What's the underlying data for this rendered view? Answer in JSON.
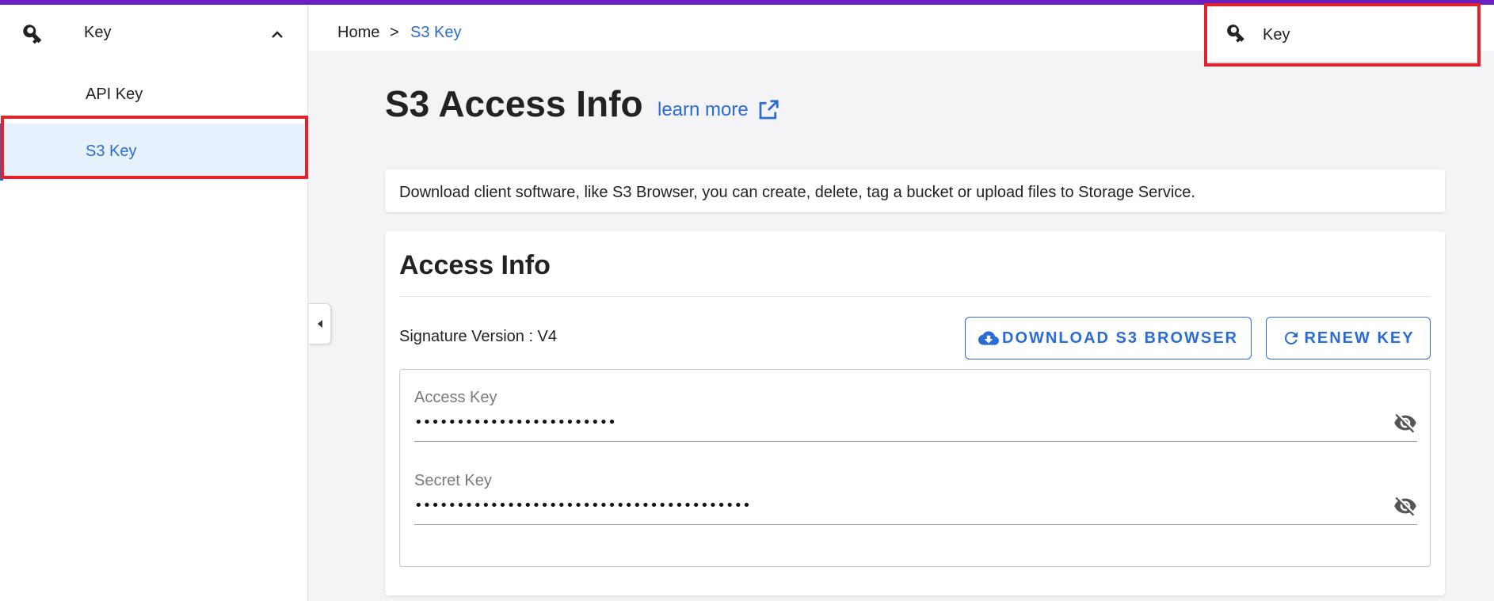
{
  "sidebar": {
    "group_label": "Key",
    "items": [
      {
        "label": "API Key"
      },
      {
        "label": "S3 Key"
      }
    ]
  },
  "breadcrumb": {
    "home": "Home",
    "separator": ">",
    "current": "S3 Key"
  },
  "menu_popup": {
    "label": "Key"
  },
  "page": {
    "title": "S3 Access Info",
    "learn_more": "learn more",
    "info_text": "Download client software, like S3 Browser, you can create, delete, tag a bucket or upload files to Storage Service."
  },
  "access": {
    "title": "Access Info",
    "signature_version": "Signature Version : V4",
    "download_button": "DOWNLOAD S3 BROWSER",
    "renew_button": "RENEW KEY",
    "access_key_label": "Access Key",
    "access_key_value": "••••••••••••••••••••••••",
    "secret_key_label": "Secret Key",
    "secret_key_value": "••••••••••••••••••••••••••••••••••••••••"
  },
  "icons": {
    "key": "key-icon",
    "chevron": "chevron-up-icon",
    "external": "open-in-new-icon",
    "download": "cloud-download-icon",
    "refresh": "refresh-icon",
    "visibility": "visibility-off-icon",
    "collapse": "caret-left-icon"
  },
  "colors": {
    "accent": "#2b6bd6",
    "topbar": "#6a1fc0",
    "highlight": "#e3232b",
    "selected_bg": "#e6f1fd"
  }
}
